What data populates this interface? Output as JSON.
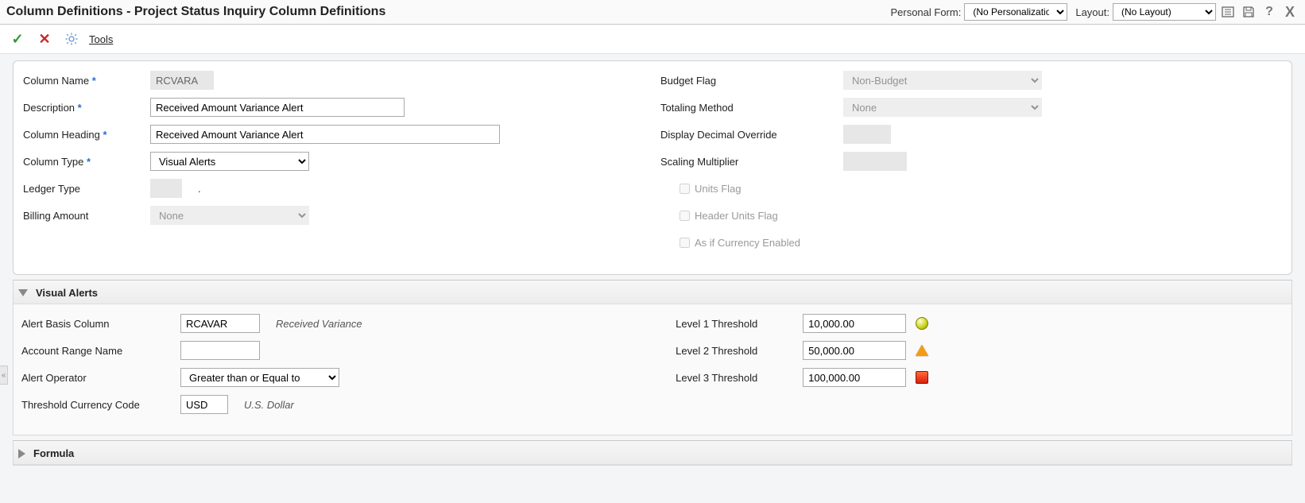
{
  "header": {
    "title": "Column Definitions - Project Status Inquiry Column Definitions",
    "personal_form_label": "Personal Form:",
    "personal_form_value": "(No Personalization)",
    "layout_label": "Layout:",
    "layout_value": "(No Layout)"
  },
  "toolbar": {
    "tools_label": "Tools"
  },
  "form": {
    "left": {
      "column_name_label": "Column Name",
      "column_name": "RCVARA",
      "description_label": "Description",
      "description": "Received Amount Variance Alert",
      "column_heading_label": "Column Heading",
      "column_heading": "Received Amount Variance Alert",
      "column_type_label": "Column Type",
      "column_type": "Visual Alerts",
      "ledger_type_label": "Ledger Type",
      "ledger_type": "",
      "ledger_type_text": ".",
      "billing_amount_label": "Billing Amount",
      "billing_amount": "None"
    },
    "right": {
      "budget_flag_label": "Budget Flag",
      "budget_flag": "Non-Budget",
      "totaling_method_label": "Totaling Method",
      "totaling_method": "None",
      "display_decimal_label": "Display Decimal Override",
      "scaling_multiplier_label": "Scaling Multiplier",
      "units_flag_label": "Units Flag",
      "header_units_flag_label": "Header Units Flag",
      "asif_currency_label": "As if Currency Enabled"
    }
  },
  "visual_alerts": {
    "title": "Visual Alerts",
    "alert_basis_label": "Alert Basis Column",
    "alert_basis": "RCAVAR",
    "alert_basis_desc": "Received Variance",
    "account_range_label": "Account Range Name",
    "account_range": "",
    "alert_operator_label": "Alert Operator",
    "alert_operator": "Greater than or Equal to",
    "threshold_currency_label": "Threshold Currency Code",
    "threshold_currency": "USD",
    "threshold_currency_desc": "U.S. Dollar",
    "level1_label": "Level 1 Threshold",
    "level1": "10,000.00",
    "level2_label": "Level 2 Threshold",
    "level2": "50,000.00",
    "level3_label": "Level 3 Threshold",
    "level3": "100,000.00"
  },
  "formula": {
    "title": "Formula"
  }
}
